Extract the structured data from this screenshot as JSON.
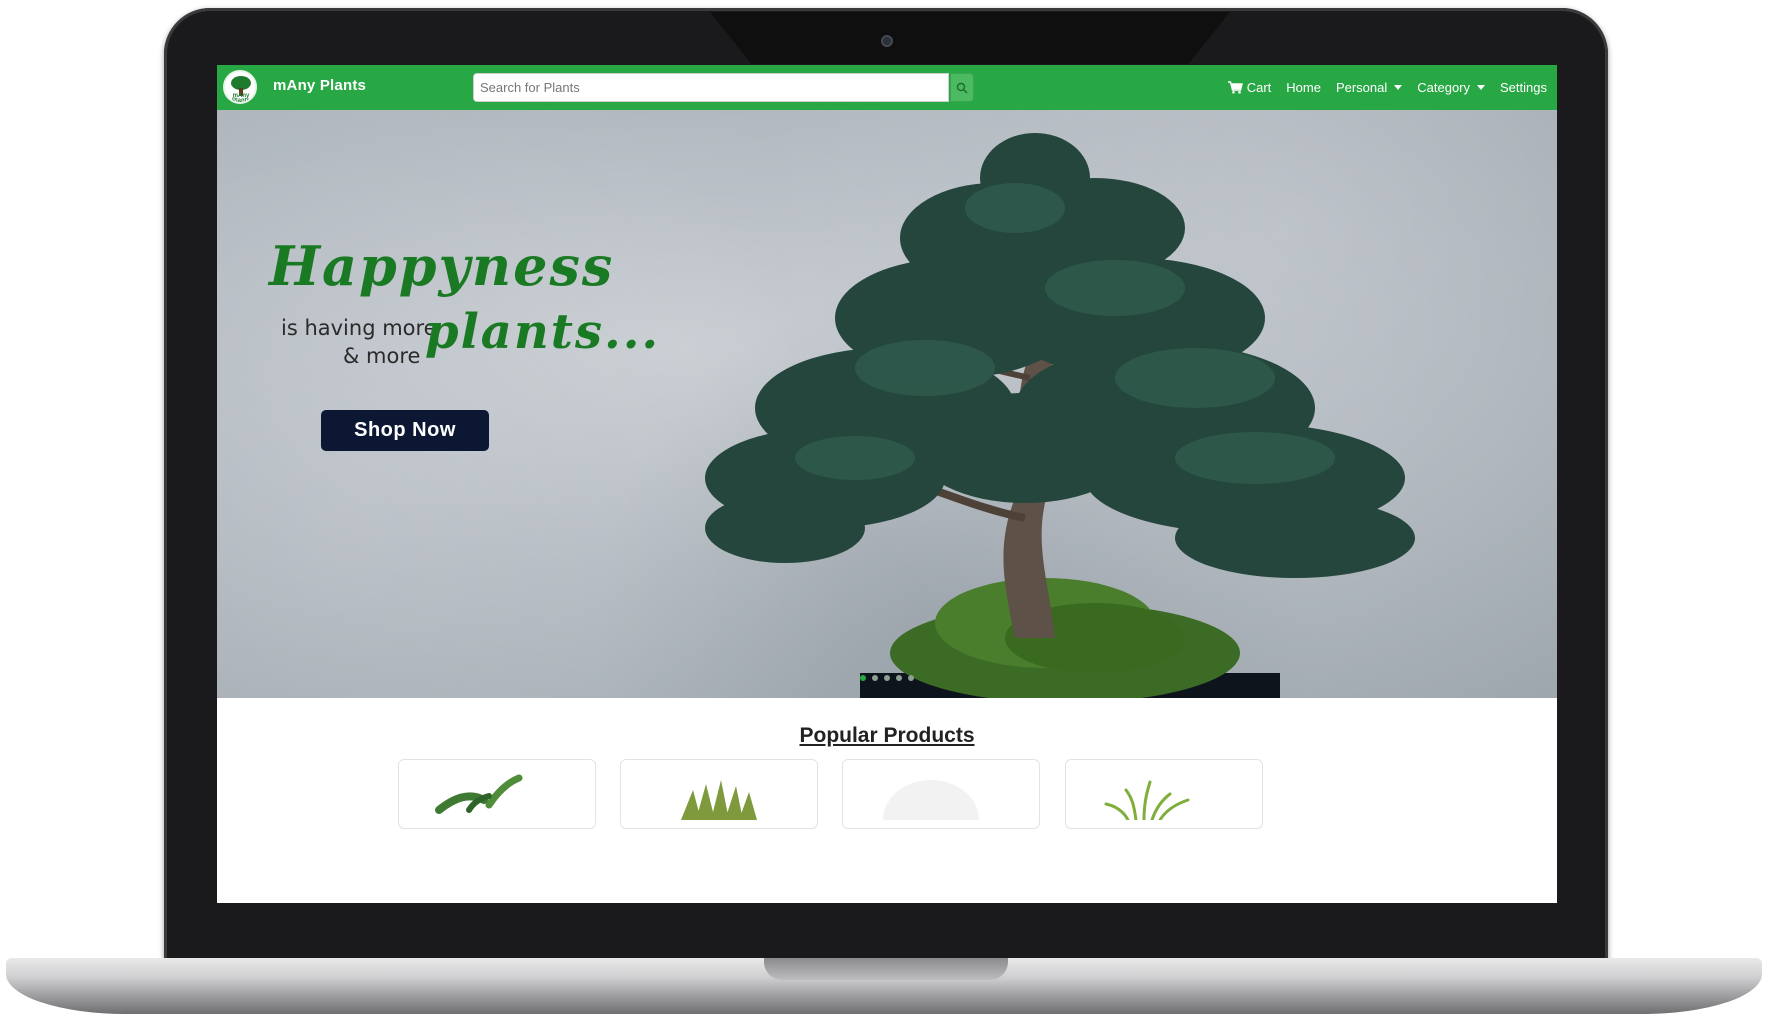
{
  "navbar": {
    "brand_name": "mAny Plants",
    "brand_logo_text": "mAny Plants",
    "search_placeholder": "Search for Plants",
    "links": {
      "cart": "Cart",
      "home": "Home",
      "personal": "Personal",
      "category": "Category",
      "settings": "Settings"
    },
    "accent_color": "#28a745"
  },
  "hero": {
    "title": "Happyness",
    "subtitle_line1": "is having more",
    "subtitle_line2": "& more",
    "highlight": "plants...",
    "cta_label": "Shop Now",
    "carousel_slide_count": 5,
    "carousel_active_index": 0
  },
  "products": {
    "heading": "Popular Products",
    "cards": [
      {
        "icon": "plant-image"
      },
      {
        "icon": "succulent-image"
      },
      {
        "icon": "plant-image"
      },
      {
        "icon": "grass-plant-image"
      }
    ]
  }
}
